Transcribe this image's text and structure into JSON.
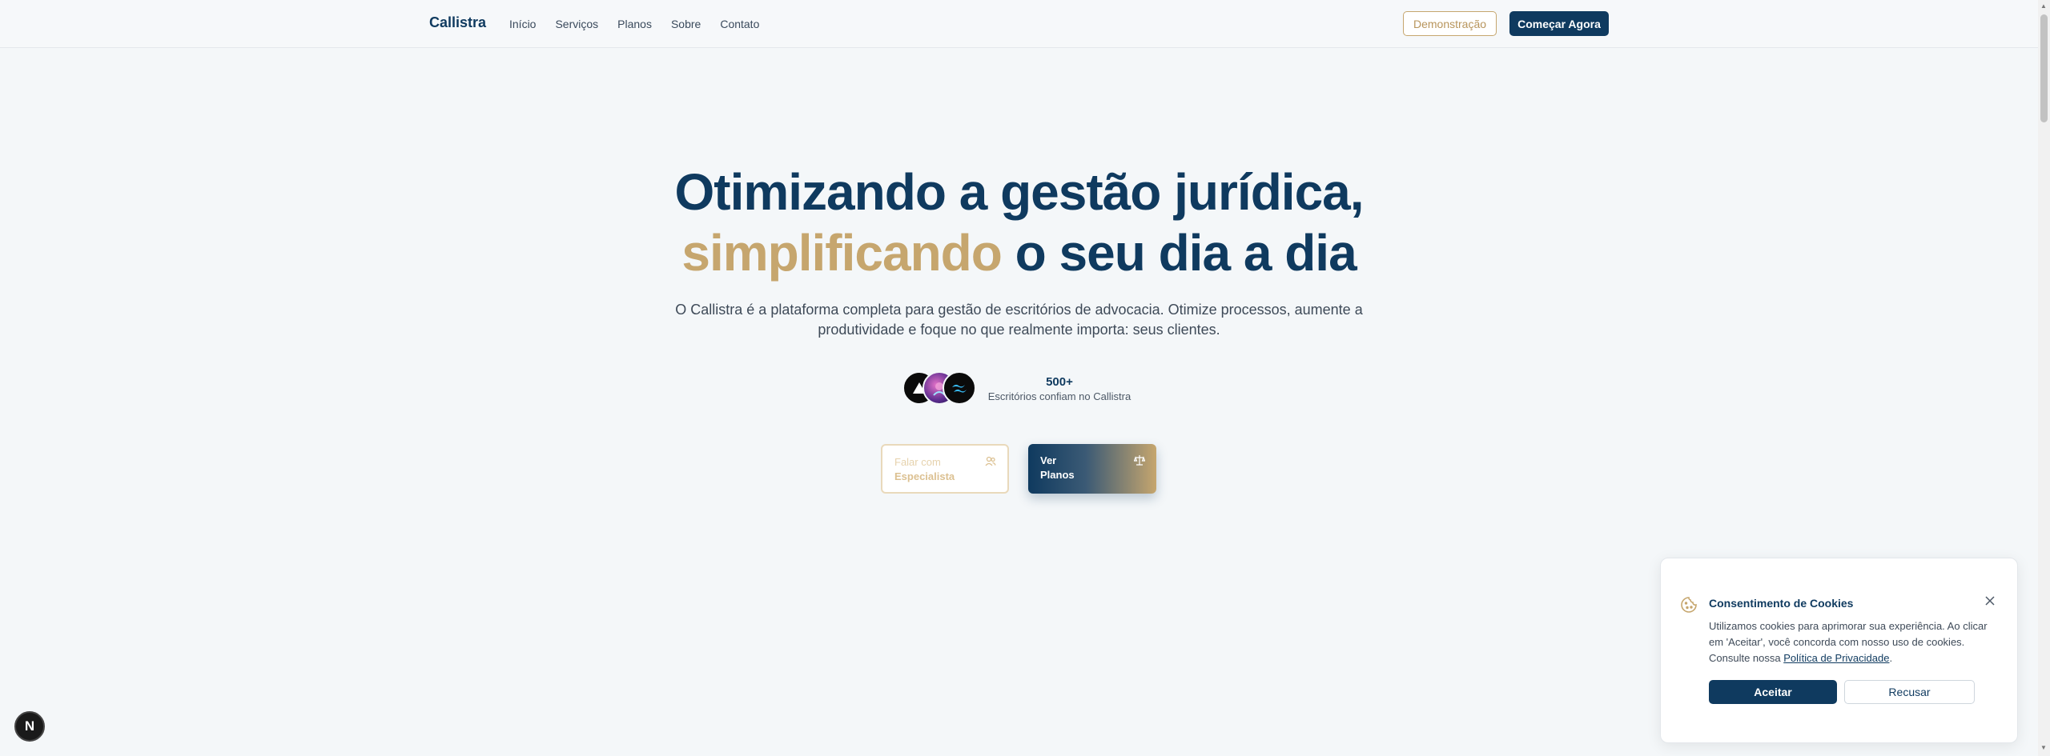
{
  "nav": {
    "brand": "Callistra",
    "links": [
      "Início",
      "Serviços",
      "Planos",
      "Sobre",
      "Contato"
    ],
    "demo_label": "Demonstração",
    "start_label": "Começar Agora"
  },
  "hero": {
    "title_line1": "Otimizando a gestão jurídica,",
    "title_highlight": "simplificando",
    "title_rest": " o seu dia a dia",
    "subtitle": "O Callistra é a plataforma completa para gestão de escritórios de advocacia. Otimize processos, aumente a produtividade e foque no que realmente importa: seus clientes.",
    "trust_count": "500+",
    "trust_label": "Escritórios confiam no Callistra",
    "cta_specialist_l1": "Falar com",
    "cta_specialist_l2": "Especialista",
    "cta_plans_l1": "Ver",
    "cta_plans_l2": "Planos"
  },
  "cookie": {
    "title": "Consentimento de Cookies",
    "text": "Utilizamos cookies para aprimorar sua experiência. Ao clicar em 'Aceitar', você concorda com nosso uso de cookies. Consulte nossa ",
    "link": "Política de Privacidade",
    "text_end": ".",
    "accept_label": "Aceitar",
    "reject_label": "Recusar"
  },
  "badge": {
    "letter": "N"
  },
  "colors": {
    "navy": "#0f3a5f",
    "gold": "#c6a66e"
  }
}
